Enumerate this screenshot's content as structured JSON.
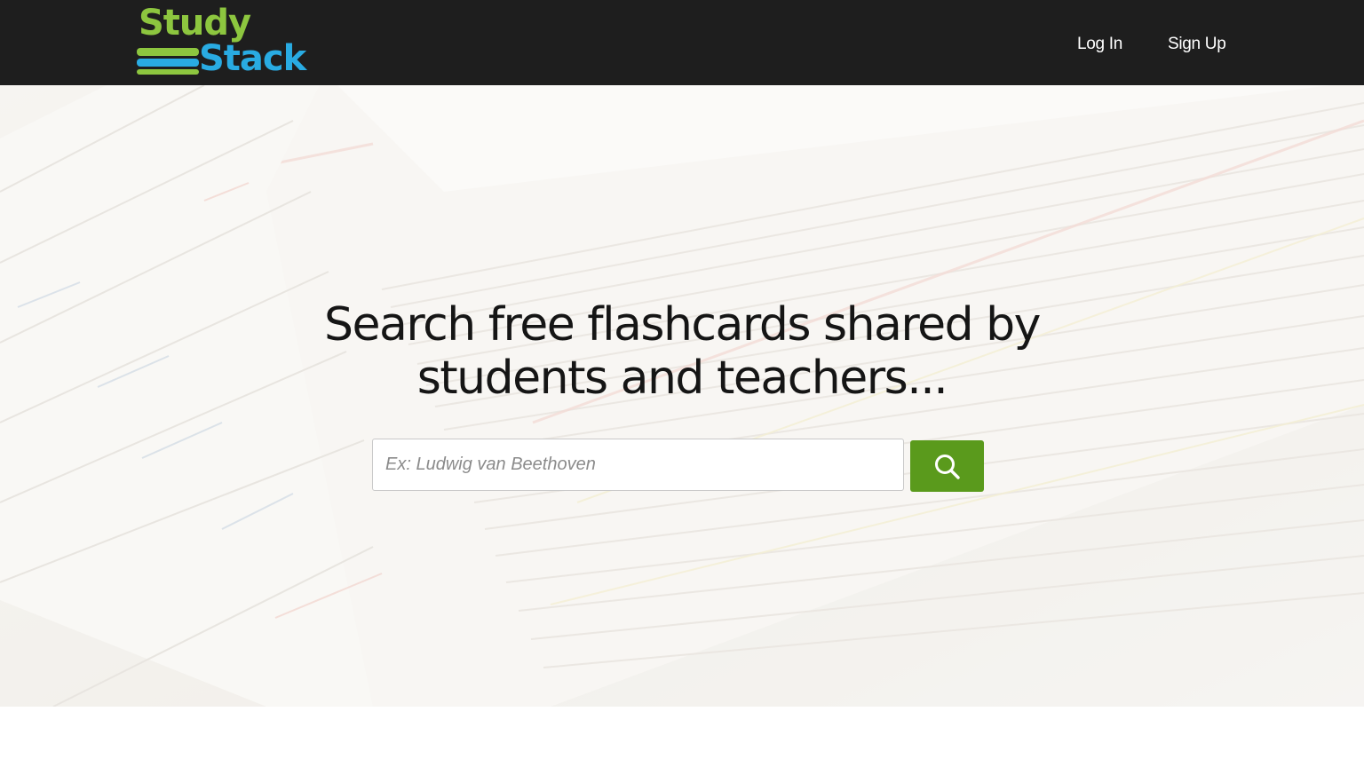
{
  "header": {
    "logo": {
      "line1": "Study",
      "line2": "Stack"
    },
    "nav": {
      "login_label": "Log In",
      "signup_label": "Sign Up"
    }
  },
  "hero": {
    "headline_line1": "Search free flashcards shared by",
    "headline_line2": "students and teachers...",
    "search": {
      "placeholder": "Ex: Ludwig van Beethoven",
      "value": "",
      "button_icon": "search-icon"
    }
  },
  "colors": {
    "header_bg": "#1e1e1e",
    "logo_green": "#8dc63f",
    "logo_blue": "#29abe2",
    "search_button": "#5a9a1c"
  }
}
